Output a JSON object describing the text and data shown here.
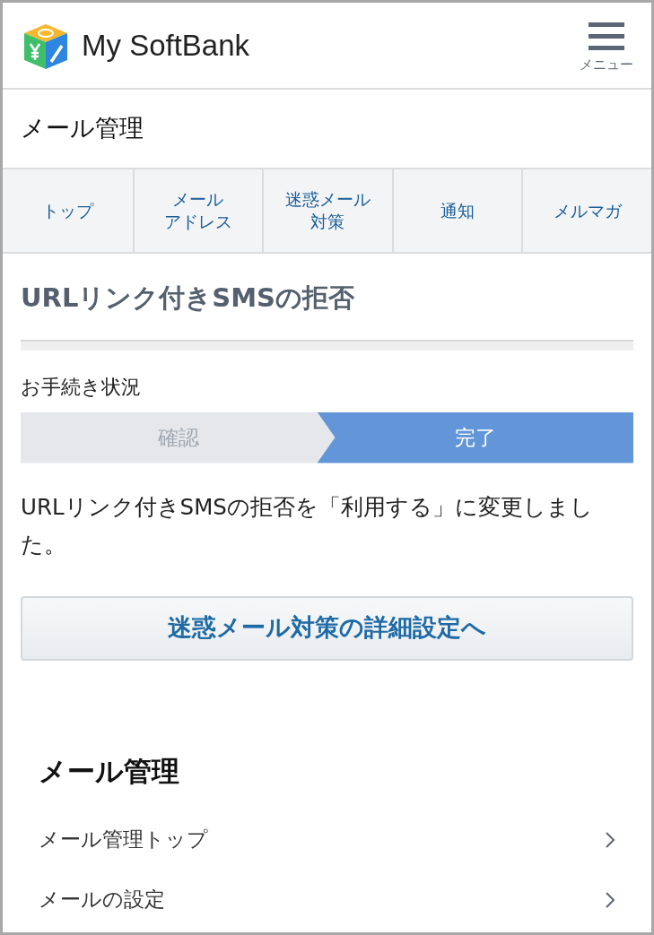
{
  "header": {
    "brand": "My SoftBank",
    "menu_label": "メニュー"
  },
  "page_title": "メール管理",
  "tabs": [
    {
      "lines": [
        "トップ"
      ]
    },
    {
      "lines": [
        "メール",
        "アドレス"
      ]
    },
    {
      "lines": [
        "迷惑メール",
        "対策"
      ]
    },
    {
      "lines": [
        "通知"
      ]
    },
    {
      "lines": [
        "メルマガ"
      ]
    }
  ],
  "heading": "URLリンク付きSMSの拒否",
  "status_label": "お手続き状況",
  "steps": [
    {
      "label": "確認",
      "selected": false
    },
    {
      "label": "完了",
      "selected": true
    }
  ],
  "message": "URLリンク付きSMSの拒否を「利用する」に変更しました。",
  "button": "迷惑メール対策の詳細設定へ",
  "section": {
    "title": "メール管理",
    "items": [
      "メール管理トップ",
      "メールの設定"
    ]
  }
}
